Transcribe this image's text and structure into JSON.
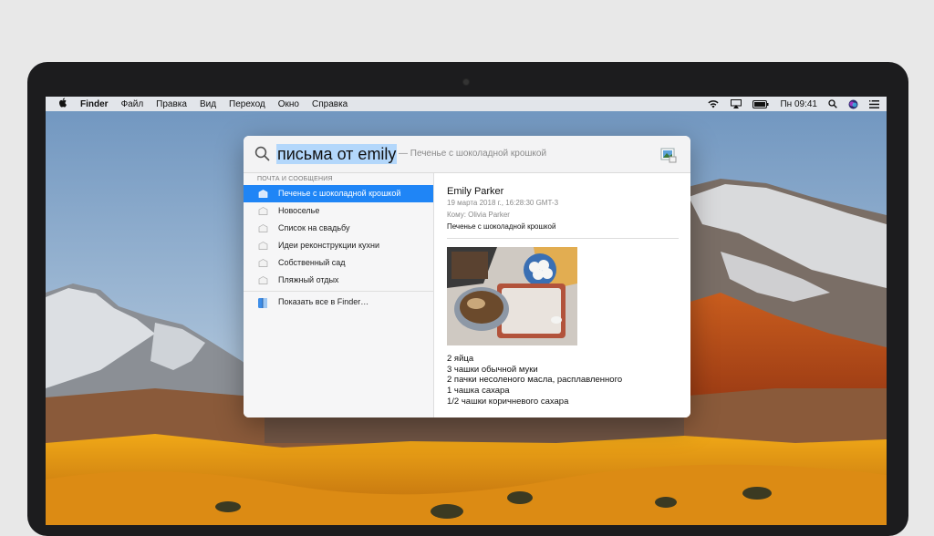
{
  "menubar": {
    "app_name": "Finder",
    "menus": [
      "Файл",
      "Правка",
      "Вид",
      "Переход",
      "Окно",
      "Справка"
    ],
    "clock": "Пн 09:41",
    "icons": [
      "apple-icon",
      "wifi-icon",
      "airplay-icon",
      "battery-icon",
      "spotlight-icon",
      "siri-icon",
      "control-menu-icon"
    ]
  },
  "spotlight": {
    "query": "письма от emily",
    "suggestion": "— Печенье с шоколадной крошкой",
    "section_title": "ПОЧТА И СООБЩЕНИЯ",
    "results": [
      {
        "label": "Печенье с шоколадной крошкой",
        "selected": true
      },
      {
        "label": "Новоселье",
        "selected": false
      },
      {
        "label": "Список на свадьбу",
        "selected": false
      },
      {
        "label": "Идеи реконструкции кухни",
        "selected": false
      },
      {
        "label": "Собственный сад",
        "selected": false
      },
      {
        "label": "Пляжный отдых",
        "selected": false
      }
    ],
    "show_all": "Показать все в Finder…"
  },
  "preview": {
    "from": "Emily Parker",
    "date": "19 марта 2018 г., 16:28:30 GMT-3",
    "to": "Кому: Olivia Parker",
    "subject": "Печенье с шоколадной крошкой",
    "body": [
      "2 яйца",
      "3 чашки обычной муки",
      "2 пачки несоленого масла, расплавленного",
      "1 чашка сахара",
      "1/2 чашки коричневого сахара"
    ]
  },
  "colors": {
    "selection": "#1f85f6",
    "query_highlight": "#b3d7fb"
  }
}
